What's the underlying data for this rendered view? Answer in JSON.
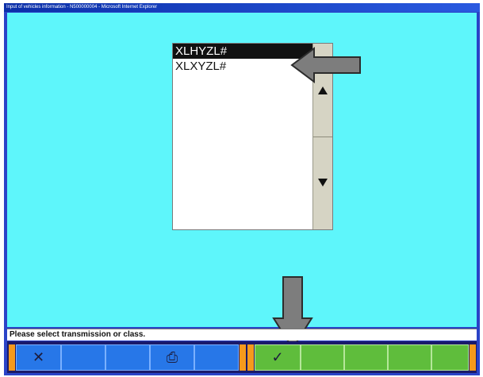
{
  "window": {
    "title": "Input of vehicles information - N500000004 - Microsoft Internet Explorer"
  },
  "list": {
    "items": [
      {
        "label": "XLHYZL#",
        "selected": true
      },
      {
        "label": "XLXYZL#",
        "selected": false
      }
    ]
  },
  "status": {
    "message": "Please select transmission or class."
  },
  "toolbar": {
    "buttons": [
      {
        "icon": "cross-icon",
        "glyph": "✕",
        "color": "#2777e8"
      },
      {
        "icon": "",
        "glyph": "",
        "color": "#2777e8"
      },
      {
        "icon": "",
        "glyph": "",
        "color": "#2777e8"
      },
      {
        "icon": "printer-icon",
        "glyph": "⎙",
        "color": "#2777e8"
      },
      {
        "icon": "",
        "glyph": "",
        "color": "#2777e8"
      },
      {
        "icon": "checkmark-icon",
        "glyph": "✓",
        "color": "#5fbd3c"
      },
      {
        "icon": "",
        "glyph": "",
        "color": "#5fbd3c"
      },
      {
        "icon": "",
        "glyph": "",
        "color": "#5fbd3c"
      },
      {
        "icon": "",
        "glyph": "",
        "color": "#5fbd3c"
      },
      {
        "icon": "",
        "glyph": "",
        "color": "#5fbd3c"
      }
    ]
  },
  "colors": {
    "background": "#5ef6fb",
    "toolbar_blue": "#2777e8",
    "toolbar_green": "#5fbd3c",
    "accent_orange": "#f59a1c",
    "selection": "#111111"
  }
}
